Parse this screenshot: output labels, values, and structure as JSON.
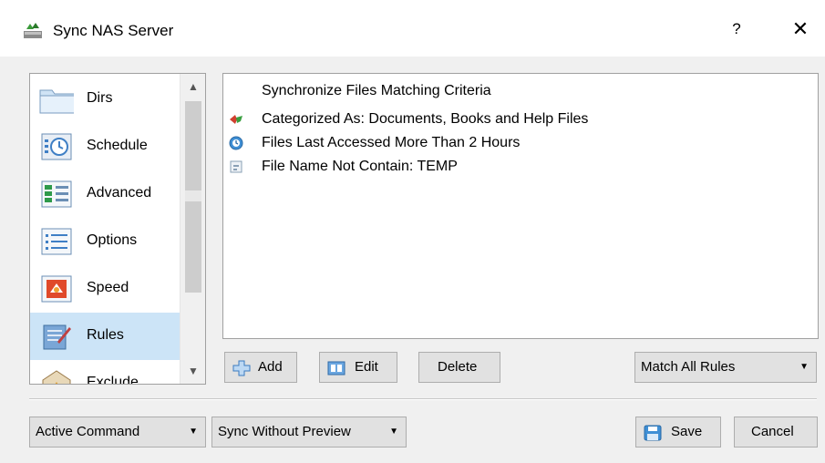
{
  "window": {
    "title": "Sync NAS Server",
    "help_label": "?",
    "close_label": "✕"
  },
  "nav": {
    "items": [
      {
        "label": "Dirs",
        "icon": "folder-icon"
      },
      {
        "label": "Schedule",
        "icon": "schedule-icon"
      },
      {
        "label": "Advanced",
        "icon": "advanced-icon"
      },
      {
        "label": "Options",
        "icon": "options-icon"
      },
      {
        "label": "Speed",
        "icon": "speed-icon"
      },
      {
        "label": "Rules",
        "icon": "rules-icon",
        "selected": true
      },
      {
        "label": "Exclude",
        "icon": "exclude-icon"
      }
    ]
  },
  "rules": {
    "header": "Synchronize Files Matching Criteria",
    "items": [
      {
        "text": "Categorized As: Documents, Books and Help Files",
        "icon": "category-icon"
      },
      {
        "text": "Files Last Accessed More Than 2 Hours",
        "icon": "clock-icon"
      },
      {
        "text": "File Name Not Contain: TEMP",
        "icon": "filename-icon"
      }
    ]
  },
  "toolbar": {
    "add_label": "Add",
    "edit_label": "Edit",
    "delete_label": "Delete",
    "match_value": "Match All Rules"
  },
  "footer": {
    "active_command": "Active Command",
    "sync_mode": "Sync Without Preview",
    "save_label": "Save",
    "cancel_label": "Cancel"
  },
  "colors": {
    "selection": "#cce4f7",
    "button_face": "#e1e1e1",
    "button_border": "#adadad"
  }
}
